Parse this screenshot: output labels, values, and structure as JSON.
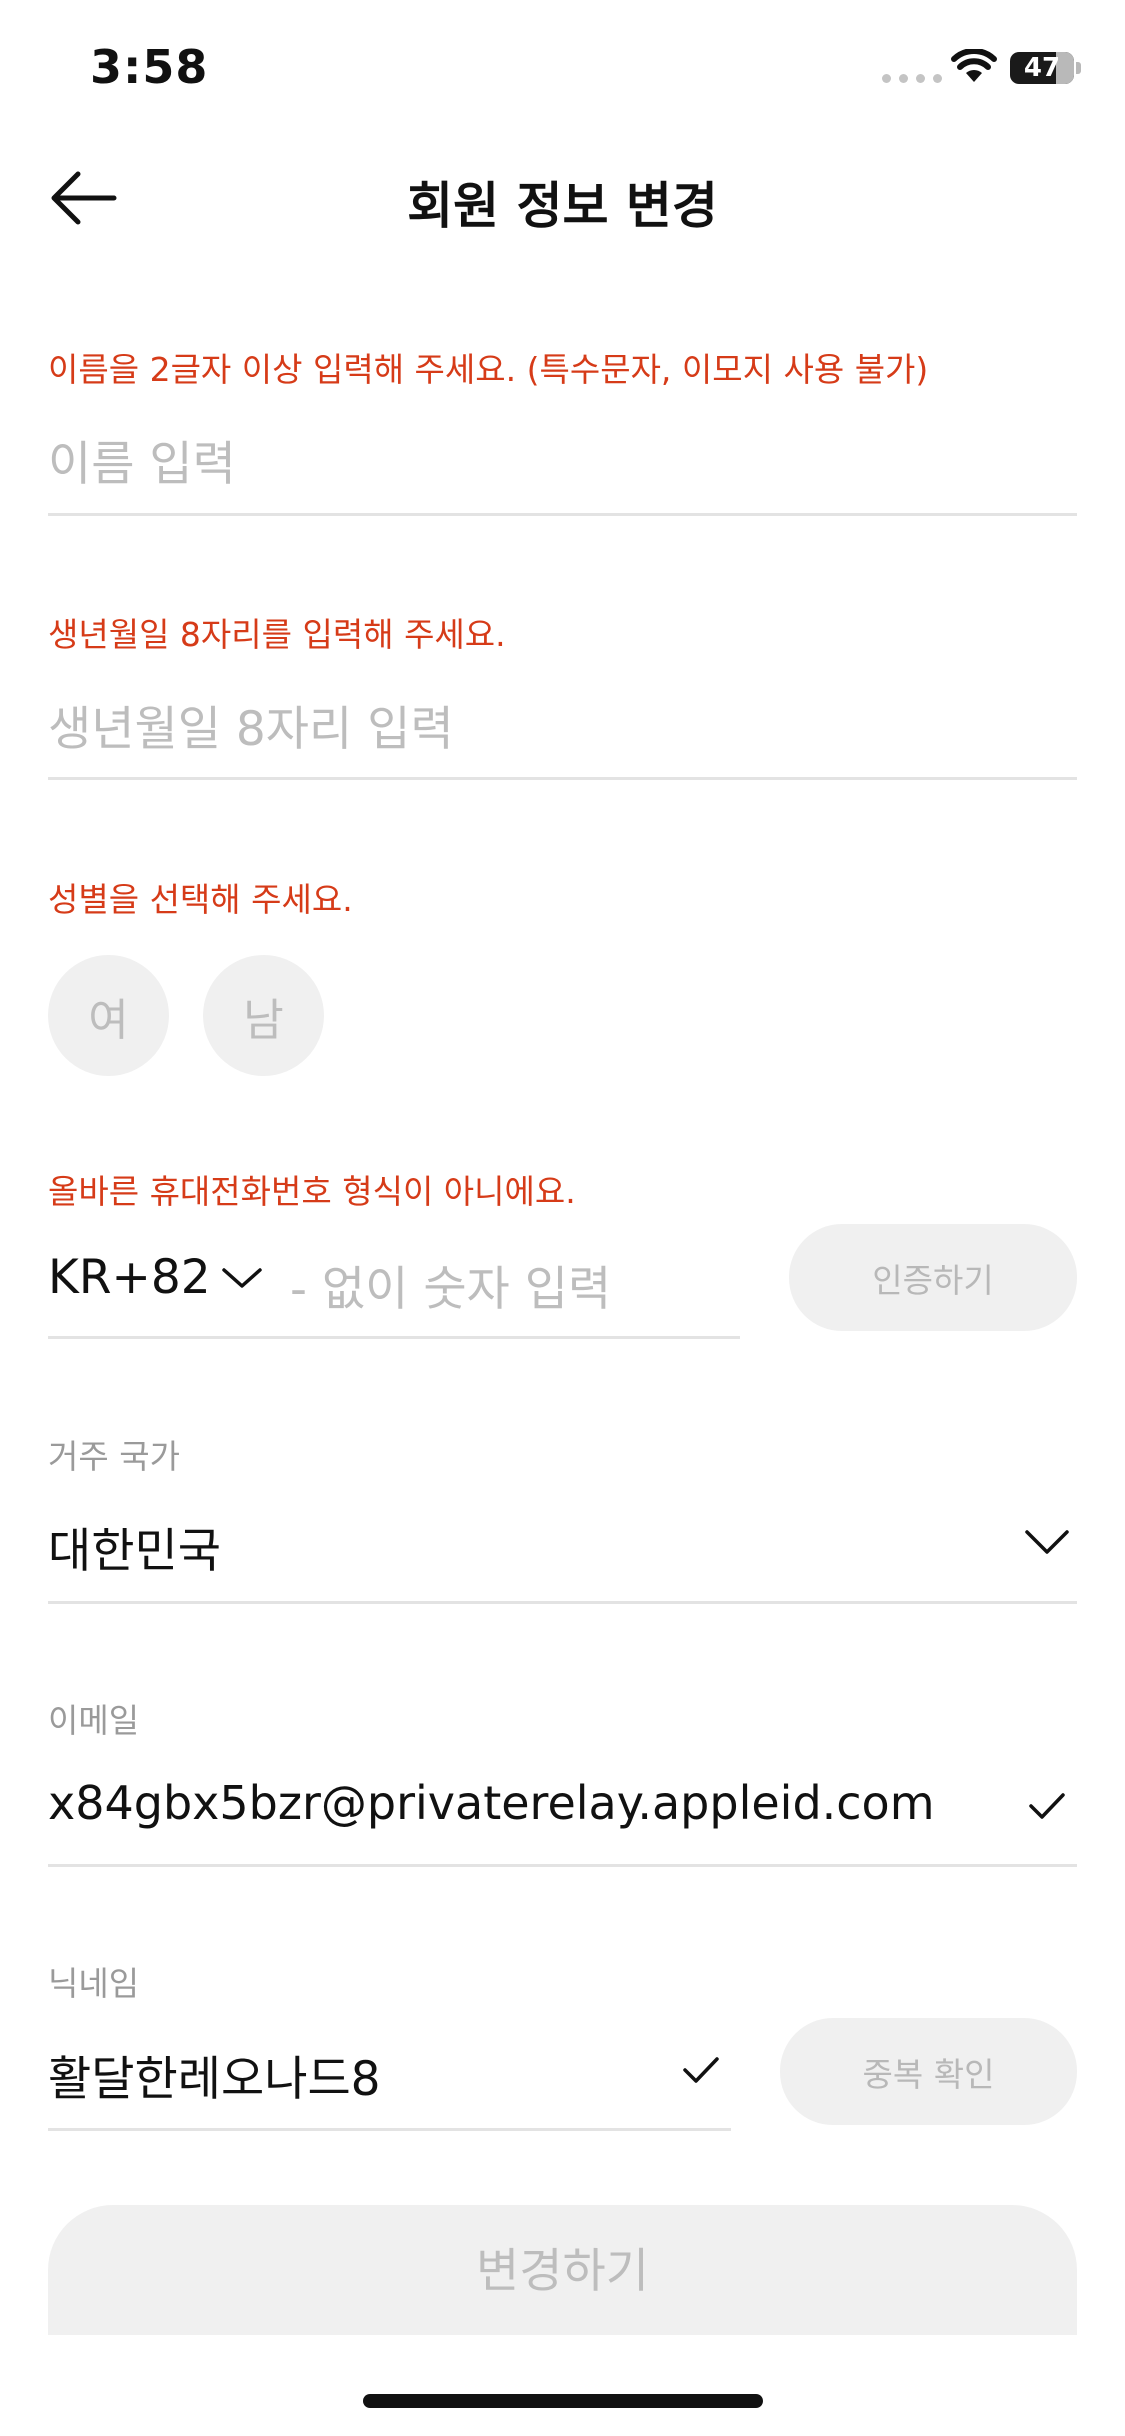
{
  "status_bar": {
    "time": "3:58",
    "battery": "47"
  },
  "header": {
    "title": "회원 정보 변경"
  },
  "name": {
    "error": "이름을 2글자 이상 입력해 주세요. (특수문자, 이모지 사용 불가)",
    "placeholder": "이름 입력"
  },
  "birth": {
    "error": "생년월일 8자리를 입력해 주세요.",
    "placeholder": "생년월일 8자리 입력"
  },
  "gender": {
    "error": "성별을 선택해 주세요.",
    "female": "여",
    "male": "남"
  },
  "phone": {
    "error": "올바른 휴대전화번호 형식이 아니에요.",
    "country_code": "KR+82",
    "placeholder": "- 없이 숫자 입력",
    "verify_button": "인증하기"
  },
  "country": {
    "label": "거주 국가",
    "value": "대한민국"
  },
  "email": {
    "label": "이메일",
    "value": "x84gbx5bzr@privaterelay.appleid.com"
  },
  "nickname": {
    "label": "닉네임",
    "value": "활달한레오나드8",
    "check_button": "중복 확인"
  },
  "submit": {
    "label": "변경하기"
  },
  "colors": {
    "error": "#d63b18",
    "disabled_bg": "#f0f0f0",
    "placeholder": "#bdbdbd"
  },
  "icons": [
    "back-arrow-icon",
    "wifi-icon",
    "battery-icon",
    "chevron-down-icon",
    "check-icon"
  ]
}
